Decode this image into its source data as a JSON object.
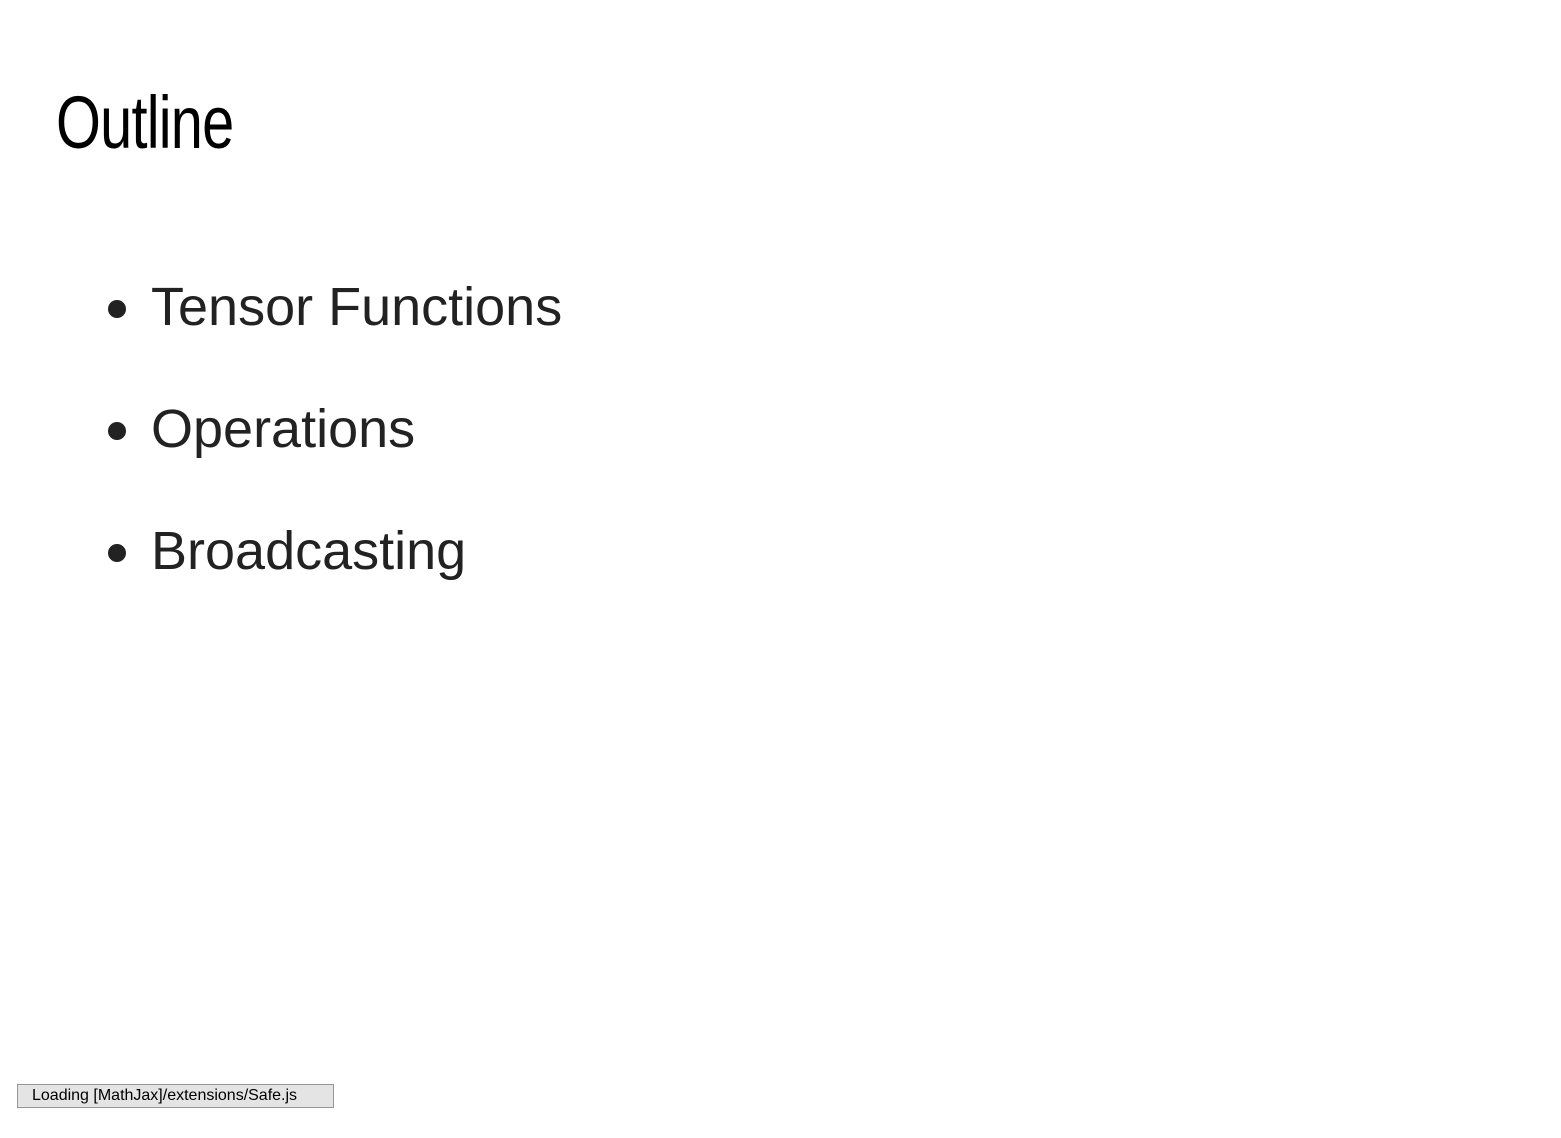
{
  "slide": {
    "title": "Outline",
    "bullets": [
      {
        "label": "Tensor Functions"
      },
      {
        "label": "Operations"
      },
      {
        "label": "Broadcasting"
      }
    ]
  },
  "status": {
    "message": "Loading [MathJax]/extensions/Safe.js"
  },
  "colors": {
    "background": "#ffffff",
    "title_text": "#000000",
    "bullet_text": "#222222",
    "status_bg": "#e4e4e4",
    "status_border": "#959595"
  }
}
